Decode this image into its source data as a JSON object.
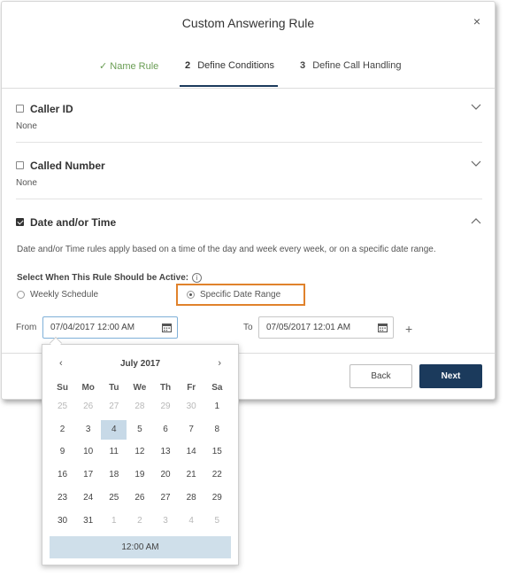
{
  "dialog": {
    "title": "Custom Answering Rule",
    "close_label": "×"
  },
  "steps": [
    {
      "check": "✓",
      "label": "Name Rule",
      "state": "done"
    },
    {
      "num": "2",
      "label": "Define Conditions",
      "state": "active"
    },
    {
      "num": "3",
      "label": "Define Call Handling",
      "state": "pending"
    }
  ],
  "sections": {
    "caller_id": {
      "title": "Caller ID",
      "value": "None",
      "checked": false
    },
    "called_number": {
      "title": "Called Number",
      "value": "None",
      "checked": false
    },
    "date_time": {
      "title": "Date and/or Time",
      "checked": true
    }
  },
  "date_time": {
    "description": "Date and/or Time rules apply based on a time of the day and week every week, or on a specific date range.",
    "select_label": "Select When This Rule Should be Active:",
    "info_icon_glyph": "i",
    "options": {
      "weekly": "Weekly Schedule",
      "specific": "Specific Date Range"
    },
    "selected_option": "specific",
    "from_label": "From",
    "from_value": "07/04/2017 12:00 AM",
    "to_label": "To",
    "to_value": "07/05/2017 12:01 AM",
    "add_label": "+"
  },
  "footer": {
    "back_label": "Back",
    "next_label": "Next"
  },
  "calendar": {
    "prev": "‹",
    "next": "›",
    "month": "July 2017",
    "weekdays": [
      "Su",
      "Mo",
      "Tu",
      "We",
      "Th",
      "Fr",
      "Sa"
    ],
    "weeks": [
      [
        "25",
        "26",
        "27",
        "28",
        "29",
        "30",
        "1"
      ],
      [
        "2",
        "3",
        "4",
        "5",
        "6",
        "7",
        "8"
      ],
      [
        "9",
        "10",
        "11",
        "12",
        "13",
        "14",
        "15"
      ],
      [
        "16",
        "17",
        "18",
        "19",
        "20",
        "21",
        "22"
      ],
      [
        "23",
        "24",
        "25",
        "26",
        "27",
        "28",
        "29"
      ],
      [
        "30",
        "31",
        "1",
        "2",
        "3",
        "4",
        "5"
      ]
    ],
    "selected_day": "4",
    "time": "12:00 AM"
  },
  "colors": {
    "primary": "#1b3a5c",
    "step_done": "#6a9d54",
    "highlight": "#e0822c",
    "selected_cell": "#c7d9e7"
  }
}
